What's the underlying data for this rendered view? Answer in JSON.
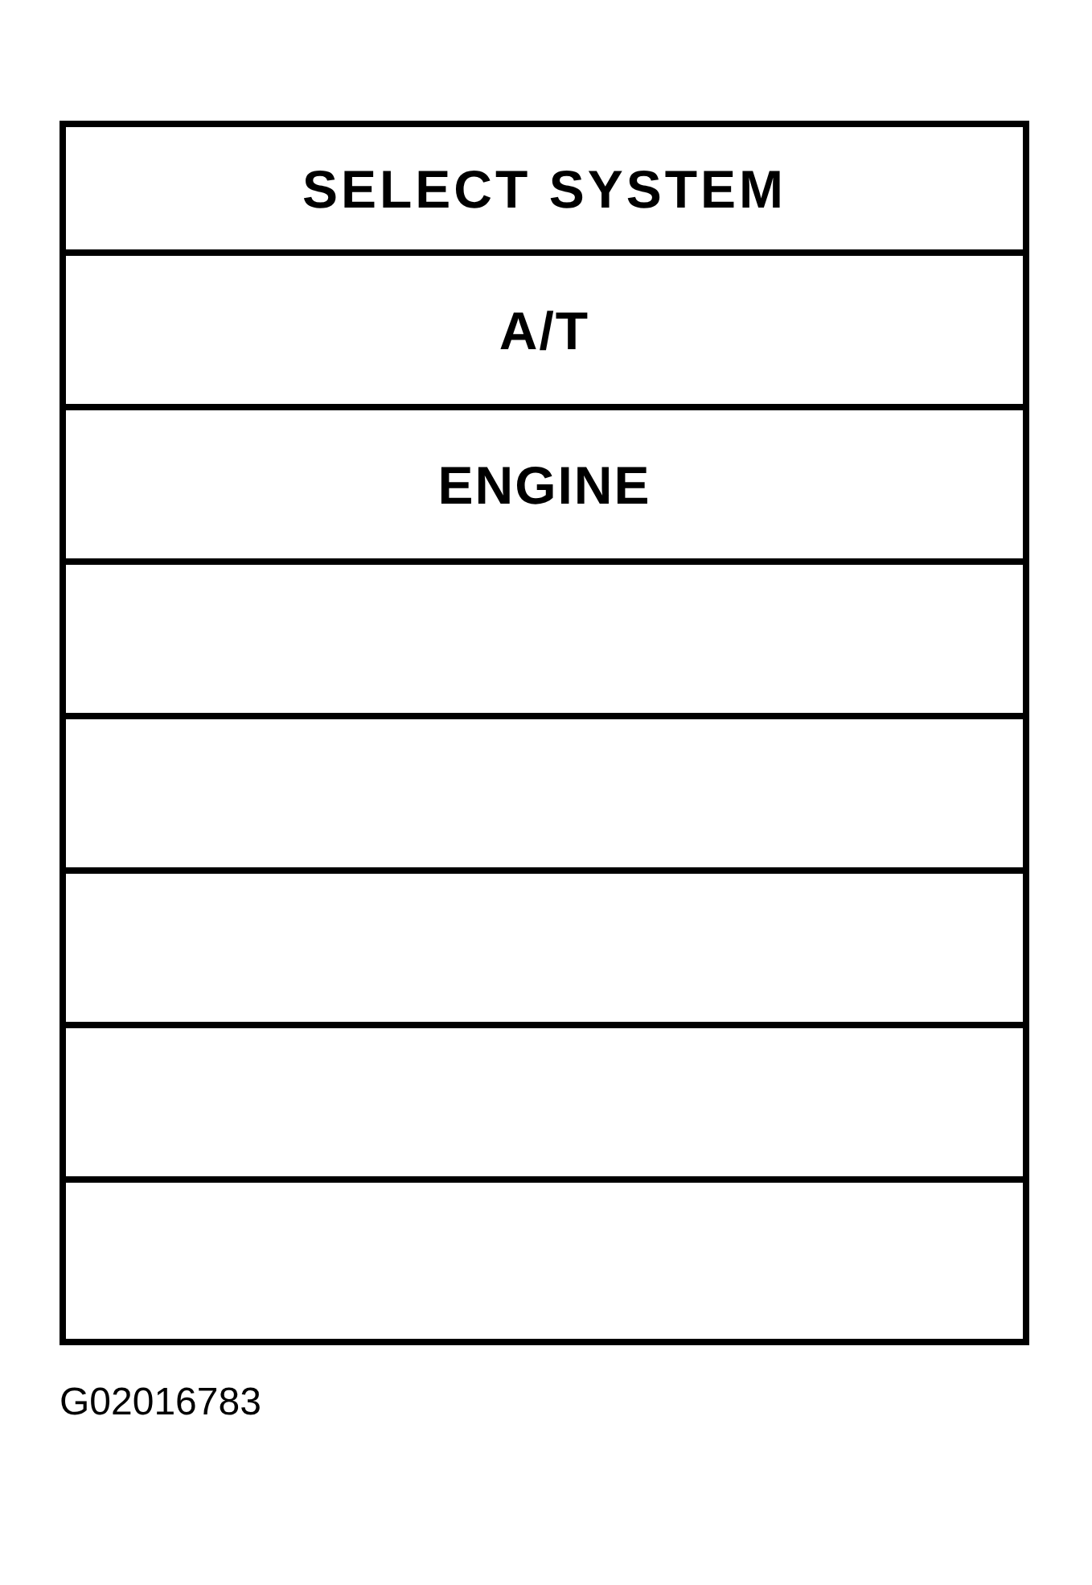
{
  "menu": {
    "title": "SELECT SYSTEM",
    "rows": [
      {
        "kind": "item",
        "label": "A/T"
      },
      {
        "kind": "item",
        "label": "ENGINE"
      },
      {
        "kind": "blank"
      },
      {
        "kind": "blank"
      },
      {
        "kind": "blank"
      },
      {
        "kind": "blank"
      },
      {
        "kind": "blank"
      }
    ]
  },
  "figure_code": "G02016783"
}
